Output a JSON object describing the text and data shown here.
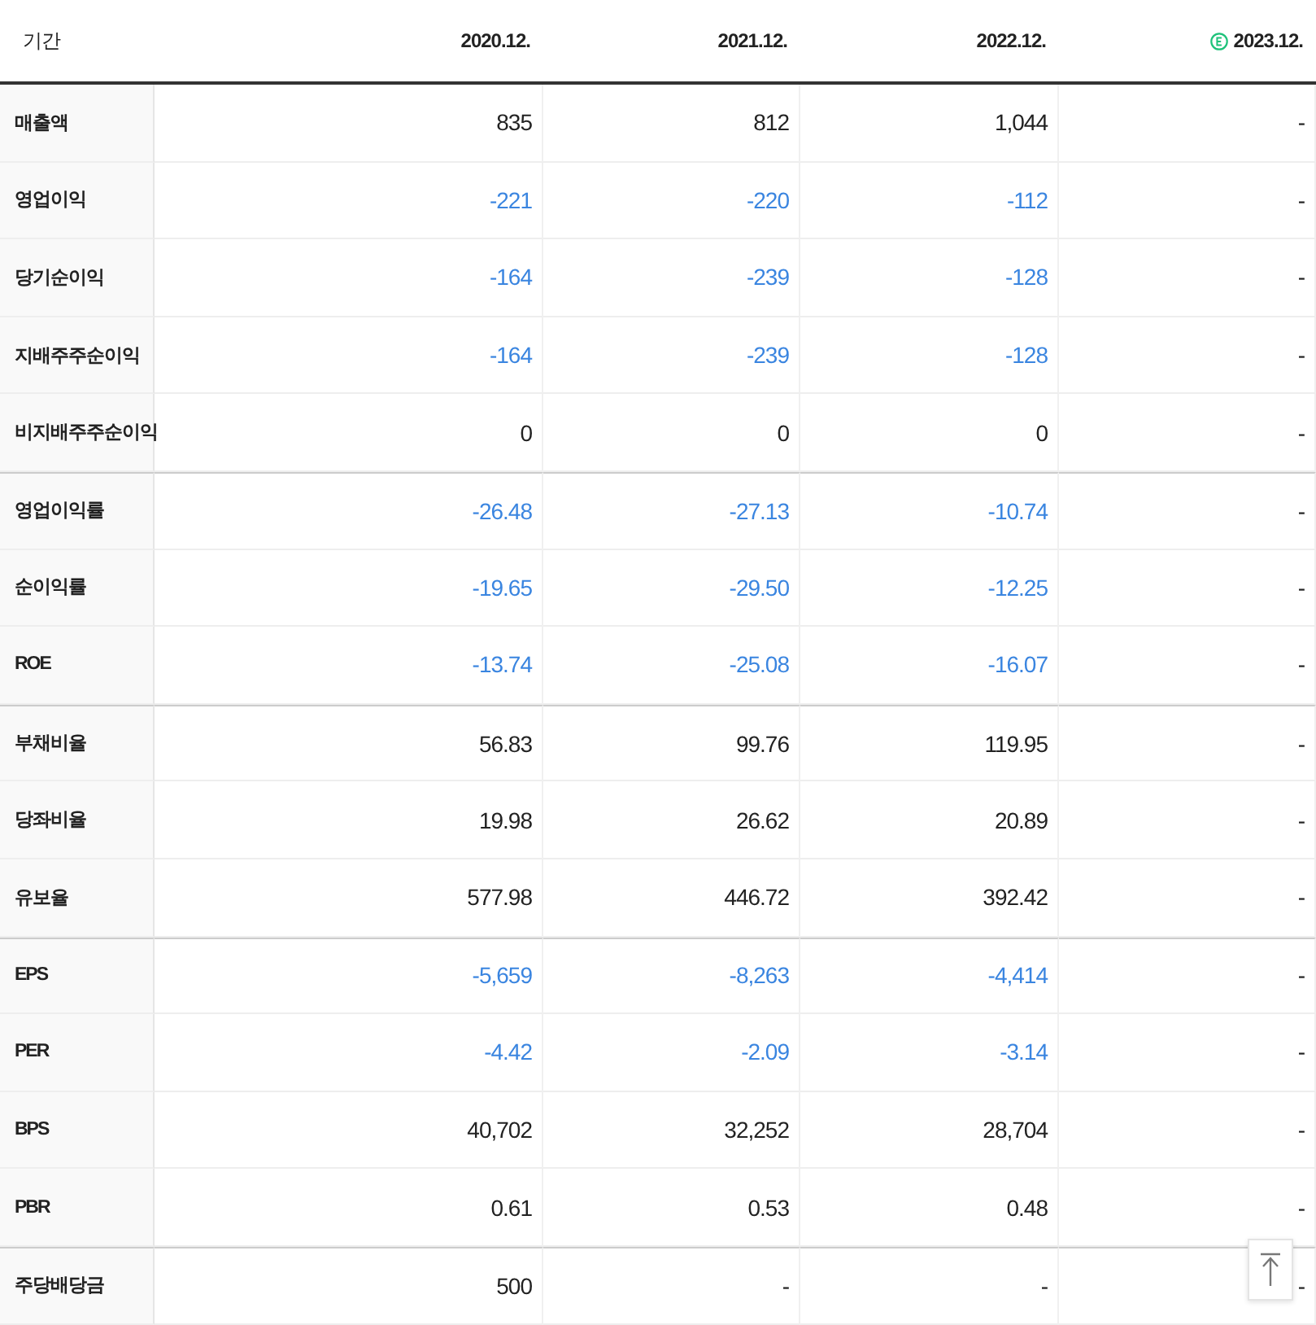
{
  "table": {
    "corner": "기간",
    "columns": [
      {
        "label": "2020.12.",
        "estimated": false
      },
      {
        "label": "2021.12.",
        "estimated": false
      },
      {
        "label": "2022.12.",
        "estimated": false
      },
      {
        "label": "2023.12.",
        "estimated": true
      }
    ],
    "groups": [
      {
        "rows": [
          {
            "label": "매출액",
            "values": [
              {
                "text": "835",
                "negative": false
              },
              {
                "text": "812",
                "negative": false
              },
              {
                "text": "1,044",
                "negative": false
              },
              {
                "text": "-",
                "negative": false
              }
            ]
          },
          {
            "label": "영업이익",
            "values": [
              {
                "text": "-221",
                "negative": true
              },
              {
                "text": "-220",
                "negative": true
              },
              {
                "text": "-112",
                "negative": true
              },
              {
                "text": "-",
                "negative": false
              }
            ]
          },
          {
            "label": "당기순이익",
            "values": [
              {
                "text": "-164",
                "negative": true
              },
              {
                "text": "-239",
                "negative": true
              },
              {
                "text": "-128",
                "negative": true
              },
              {
                "text": "-",
                "negative": false
              }
            ]
          },
          {
            "label": "지배주주순이익",
            "values": [
              {
                "text": "-164",
                "negative": true
              },
              {
                "text": "-239",
                "negative": true
              },
              {
                "text": "-128",
                "negative": true
              },
              {
                "text": "-",
                "negative": false
              }
            ]
          },
          {
            "label": "비지배주주순이익",
            "values": [
              {
                "text": "0",
                "negative": false
              },
              {
                "text": "0",
                "negative": false
              },
              {
                "text": "0",
                "negative": false
              },
              {
                "text": "-",
                "negative": false
              }
            ]
          }
        ]
      },
      {
        "rows": [
          {
            "label": "영업이익률",
            "values": [
              {
                "text": "-26.48",
                "negative": true
              },
              {
                "text": "-27.13",
                "negative": true
              },
              {
                "text": "-10.74",
                "negative": true
              },
              {
                "text": "-",
                "negative": false
              }
            ]
          },
          {
            "label": "순이익률",
            "values": [
              {
                "text": "-19.65",
                "negative": true
              },
              {
                "text": "-29.50",
                "negative": true
              },
              {
                "text": "-12.25",
                "negative": true
              },
              {
                "text": "-",
                "negative": false
              }
            ]
          },
          {
            "label": "ROE",
            "values": [
              {
                "text": "-13.74",
                "negative": true
              },
              {
                "text": "-25.08",
                "negative": true
              },
              {
                "text": "-16.07",
                "negative": true
              },
              {
                "text": "-",
                "negative": false
              }
            ]
          }
        ]
      },
      {
        "rows": [
          {
            "label": "부채비율",
            "values": [
              {
                "text": "56.83",
                "negative": false
              },
              {
                "text": "99.76",
                "negative": false
              },
              {
                "text": "119.95",
                "negative": false
              },
              {
                "text": "-",
                "negative": false
              }
            ]
          },
          {
            "label": "당좌비율",
            "values": [
              {
                "text": "19.98",
                "negative": false
              },
              {
                "text": "26.62",
                "negative": false
              },
              {
                "text": "20.89",
                "negative": false
              },
              {
                "text": "-",
                "negative": false
              }
            ]
          },
          {
            "label": "유보율",
            "values": [
              {
                "text": "577.98",
                "negative": false
              },
              {
                "text": "446.72",
                "negative": false
              },
              {
                "text": "392.42",
                "negative": false
              },
              {
                "text": "-",
                "negative": false
              }
            ]
          }
        ]
      },
      {
        "rows": [
          {
            "label": "EPS",
            "values": [
              {
                "text": "-5,659",
                "negative": true
              },
              {
                "text": "-8,263",
                "negative": true
              },
              {
                "text": "-4,414",
                "negative": true
              },
              {
                "text": "-",
                "negative": false
              }
            ]
          },
          {
            "label": "PER",
            "values": [
              {
                "text": "-4.42",
                "negative": true
              },
              {
                "text": "-2.09",
                "negative": true
              },
              {
                "text": "-3.14",
                "negative": true
              },
              {
                "text": "-",
                "negative": false
              }
            ]
          },
          {
            "label": "BPS",
            "values": [
              {
                "text": "40,702",
                "negative": false
              },
              {
                "text": "32,252",
                "negative": false
              },
              {
                "text": "28,704",
                "negative": false
              },
              {
                "text": "-",
                "negative": false
              }
            ]
          },
          {
            "label": "PBR",
            "values": [
              {
                "text": "0.61",
                "negative": false
              },
              {
                "text": "0.53",
                "negative": false
              },
              {
                "text": "0.48",
                "negative": false
              },
              {
                "text": "-",
                "negative": false
              }
            ]
          }
        ]
      },
      {
        "rows": [
          {
            "label": "주당배당금",
            "values": [
              {
                "text": "500",
                "negative": false
              },
              {
                "text": "-",
                "negative": false
              },
              {
                "text": "-",
                "negative": false
              },
              {
                "text": "-",
                "negative": false
              }
            ]
          }
        ]
      }
    ]
  }
}
